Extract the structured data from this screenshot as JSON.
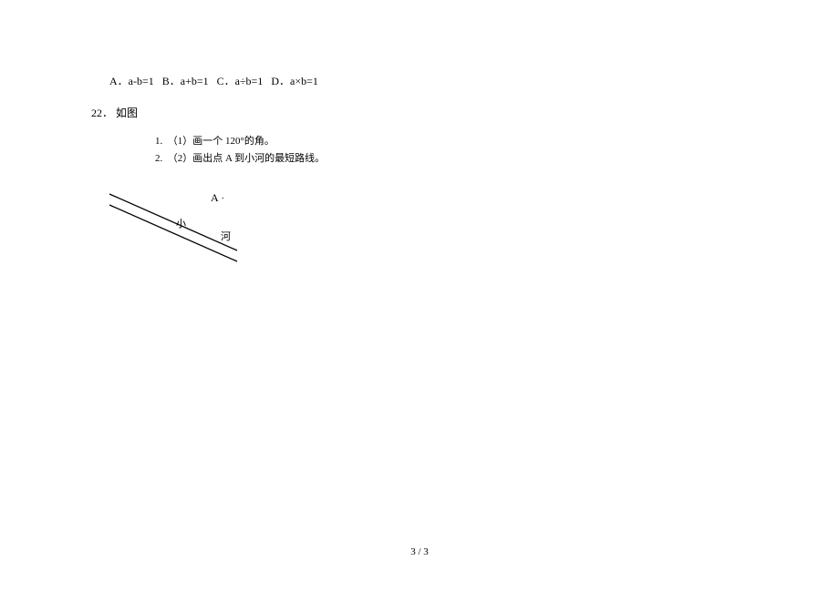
{
  "options": {
    "A": "A．a-b=1",
    "B": "B．a+b=1",
    "C": "C．a÷b=1",
    "D": "D．a×b=1"
  },
  "question": {
    "number": "22．",
    "title": "如图",
    "subitems": [
      {
        "index": "1.",
        "label": "（1）",
        "text": "画一个 120°的角。"
      },
      {
        "index": "2.",
        "label": "（2）",
        "text": "画出点 A 到小河的最短路线。"
      }
    ]
  },
  "diagram": {
    "pointLabel": "A",
    "char1": "小",
    "char2": "河"
  },
  "pageNumber": "3 / 3"
}
